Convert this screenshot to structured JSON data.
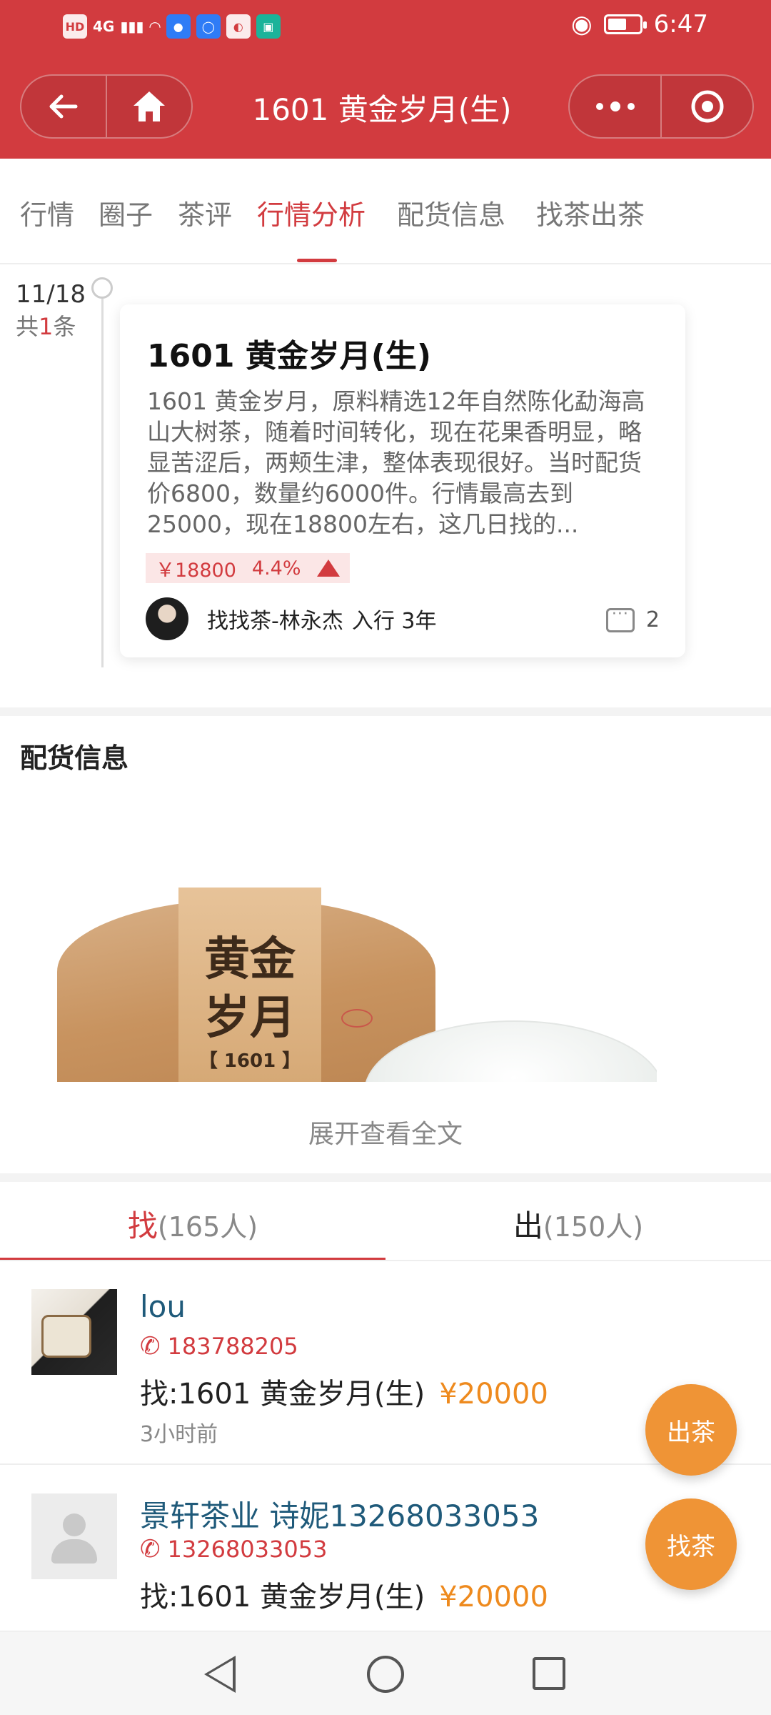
{
  "status_bar": {
    "time": "6:47",
    "network": "4G",
    "hd_label": "HD",
    "battery_level": 0.6
  },
  "header": {
    "title": "1601 黄金岁月(生)",
    "back_icon": "arrow-left-icon",
    "home_icon": "home-icon",
    "more_icon": "more-dots-icon",
    "target_icon": "target-icon",
    "theme_color": "#d23b3f"
  },
  "tabs": [
    {
      "label": "行情",
      "active": false
    },
    {
      "label": "圈子",
      "active": false
    },
    {
      "label": "茶评",
      "active": false
    },
    {
      "label": "行情分析",
      "active": true
    },
    {
      "label": "配货信息",
      "active": false
    },
    {
      "label": "找茶出茶",
      "active": false
    }
  ],
  "timeline": {
    "date": "11/18",
    "count_prefix": "共",
    "count": "1",
    "count_suffix": "条"
  },
  "analysis_card": {
    "title": "1601 黄金岁月(生)",
    "body": "1601 黄金岁月，原料精选12年自然陈化勐海高山大树茶，随着时间转化，现在花果香明显，略显苦涩后，两颊生津，整体表现很好。当时配货价6800，数量约6000件。行情最高去到25000，现在18800左右，这几日找的...",
    "price": "￥18800",
    "change": "4.4%",
    "trend": "up",
    "author": "找找茶-林永杰",
    "experience": "入行 3年",
    "comment_count": "2"
  },
  "distribution": {
    "title": "配货信息",
    "image_text_line1": "黄金",
    "image_text_line2": "岁月",
    "image_code": "【 1601 】",
    "expand_label": "展开查看全文"
  },
  "find_sell_tabs": [
    {
      "label": "找",
      "count": "(165人)",
      "active": true
    },
    {
      "label": "出",
      "count": "(150人)",
      "active": false
    }
  ],
  "listings": [
    {
      "name": "lou",
      "phone": "183788205",
      "want": "找:1601 黄金岁月(生)",
      "price": "¥20000",
      "time": "3小时前",
      "avatar": "photo"
    },
    {
      "name": "景轩茶业 诗妮13268033053",
      "phone": "13268033053",
      "want": "找:1601 黄金岁月(生)",
      "price": "¥20000",
      "time": "",
      "avatar": "default"
    }
  ],
  "fabs": {
    "sell_label": "出茶",
    "find_label": "找茶",
    "color": "#ef9436"
  },
  "system_nav": [
    "back-icon",
    "home-circle-icon",
    "recent-apps-icon"
  ]
}
